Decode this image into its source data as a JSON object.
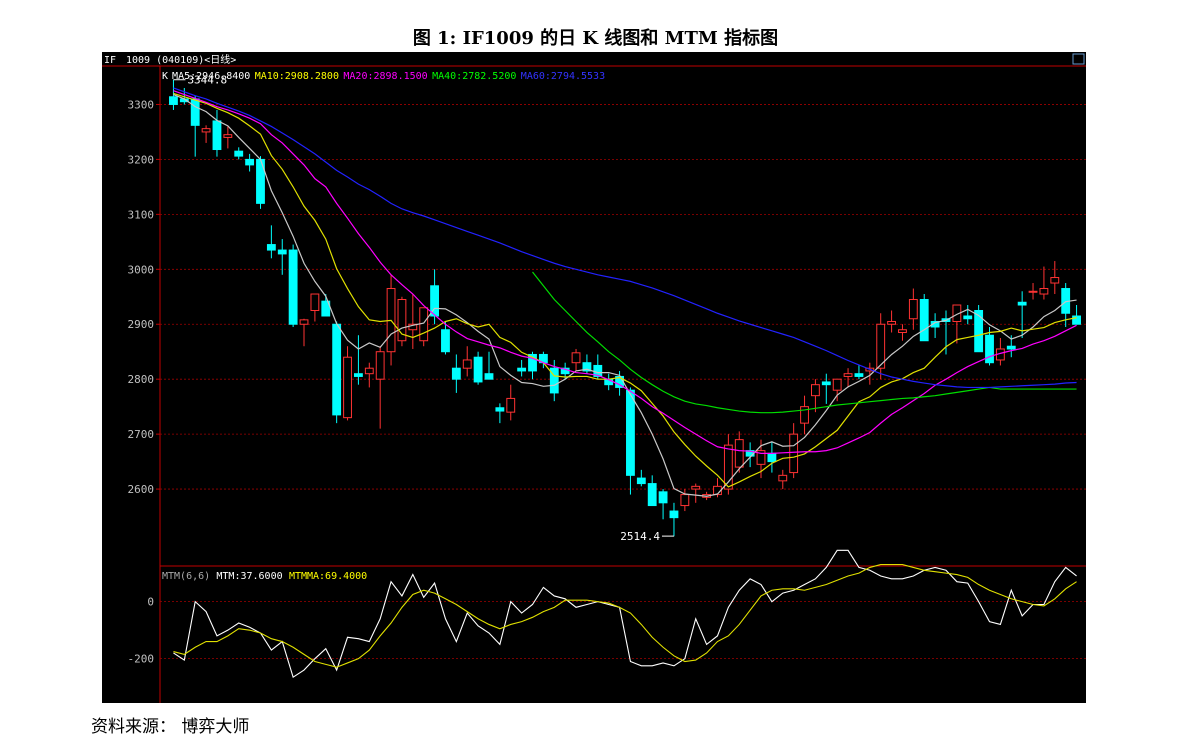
{
  "figure_title": "图 1:  IF1009 的日 K 线图和 MTM 指标图",
  "source_label": "资料来源：  博弈大师",
  "header": {
    "symbol": "IF",
    "contract": "1009",
    "code": "(040109)",
    "period": "<日线>"
  },
  "main_legend": [
    {
      "label": "K",
      "color": "#ffffff"
    },
    {
      "label": "MA5:2946.8400",
      "color": "#ffffff"
    },
    {
      "label": "MA10:2908.2800",
      "color": "#ffff00"
    },
    {
      "label": "MA20:2898.1500",
      "color": "#ff00ff"
    },
    {
      "label": "MA40:2782.5200",
      "color": "#00ff00"
    },
    {
      "label": "MA60:2794.5533",
      "color": "#3333ff"
    }
  ],
  "sub_legend": [
    {
      "label": "MTM(6,6)",
      "color": "#aaaaaa"
    },
    {
      "label": "MTM:37.6000",
      "color": "#ffffff"
    },
    {
      "label": "MTMMA:69.4000",
      "color": "#ffff00"
    }
  ],
  "annotations": {
    "high": "3344.8",
    "low": "2514.4"
  },
  "colors": {
    "up": "#ff3333",
    "down": "#00ffff",
    "grid": "#a00000",
    "axis": "#c00000",
    "panel_bg": "#000000"
  },
  "chart_data": [
    {
      "type": "candlestick",
      "title": "IF1009 日K线",
      "y_ticks": [
        2600,
        2700,
        2800,
        2900,
        3000,
        3100,
        3200,
        3300
      ],
      "ylim": [
        2460,
        3370
      ],
      "candles": [
        [
          3314,
          3345,
          3290,
          3300
        ],
        [
          3310,
          3330,
          3300,
          3305
        ],
        [
          3310,
          3316,
          3205,
          3262
        ],
        [
          3250,
          3262,
          3230,
          3256
        ],
        [
          3270,
          3290,
          3205,
          3218
        ],
        [
          3240,
          3260,
          3220,
          3245
        ],
        [
          3215,
          3222,
          3200,
          3206
        ],
        [
          3200,
          3210,
          3178,
          3190
        ],
        [
          3200,
          3206,
          3110,
          3120
        ],
        [
          3045,
          3080,
          3020,
          3035
        ],
        [
          3035,
          3055,
          2990,
          3028
        ],
        [
          3035,
          3045,
          2895,
          2900
        ],
        [
          2900,
          2910,
          2860,
          2908
        ],
        [
          2925,
          2950,
          2905,
          2955
        ],
        [
          2942,
          2955,
          2915,
          2915
        ],
        [
          2900,
          2905,
          2720,
          2735
        ],
        [
          2730,
          2860,
          2725,
          2840
        ],
        [
          2810,
          2880,
          2790,
          2805
        ],
        [
          2810,
          2830,
          2785,
          2820
        ],
        [
          2800,
          2860,
          2710,
          2850
        ],
        [
          2850,
          2990,
          2825,
          2965
        ],
        [
          2870,
          2950,
          2860,
          2945
        ],
        [
          2890,
          2955,
          2855,
          2900
        ],
        [
          2870,
          2920,
          2860,
          2930
        ],
        [
          2970,
          3000,
          2900,
          2915
        ],
        [
          2890,
          2905,
          2845,
          2850
        ],
        [
          2820,
          2845,
          2775,
          2800
        ],
        [
          2820,
          2860,
          2805,
          2835
        ],
        [
          2840,
          2850,
          2790,
          2795
        ],
        [
          2810,
          2850,
          2800,
          2800
        ],
        [
          2748,
          2756,
          2720,
          2742
        ],
        [
          2740,
          2790,
          2725,
          2765
        ],
        [
          2820,
          2835,
          2805,
          2815
        ],
        [
          2845,
          2850,
          2800,
          2815
        ],
        [
          2845,
          2850,
          2820,
          2830
        ],
        [
          2820,
          2835,
          2760,
          2775
        ],
        [
          2820,
          2830,
          2800,
          2810
        ],
        [
          2830,
          2855,
          2815,
          2848
        ],
        [
          2830,
          2845,
          2810,
          2815
        ],
        [
          2825,
          2845,
          2800,
          2805
        ],
        [
          2800,
          2810,
          2780,
          2790
        ],
        [
          2805,
          2815,
          2770,
          2785
        ],
        [
          2780,
          2785,
          2590,
          2625
        ],
        [
          2620,
          2635,
          2605,
          2610
        ],
        [
          2610,
          2625,
          2570,
          2570
        ],
        [
          2595,
          2600,
          2545,
          2575
        ],
        [
          2560,
          2575,
          2514,
          2548
        ],
        [
          2570,
          2600,
          2560,
          2590
        ],
        [
          2600,
          2610,
          2575,
          2605
        ],
        [
          2585,
          2595,
          2580,
          2590
        ],
        [
          2590,
          2620,
          2585,
          2605
        ],
        [
          2600,
          2700,
          2590,
          2680
        ],
        [
          2640,
          2705,
          2630,
          2690
        ],
        [
          2670,
          2685,
          2640,
          2660
        ],
        [
          2645,
          2690,
          2620,
          2670
        ],
        [
          2665,
          2685,
          2630,
          2650
        ],
        [
          2615,
          2635,
          2600,
          2625
        ],
        [
          2630,
          2720,
          2620,
          2700
        ],
        [
          2720,
          2770,
          2700,
          2750
        ],
        [
          2770,
          2800,
          2740,
          2790
        ],
        [
          2795,
          2810,
          2755,
          2790
        ],
        [
          2780,
          2800,
          2760,
          2800
        ],
        [
          2805,
          2820,
          2785,
          2810
        ],
        [
          2810,
          2825,
          2800,
          2805
        ],
        [
          2815,
          2830,
          2790,
          2820
        ],
        [
          2820,
          2920,
          2800,
          2900
        ],
        [
          2900,
          2925,
          2885,
          2905
        ],
        [
          2885,
          2900,
          2870,
          2890
        ],
        [
          2910,
          2965,
          2890,
          2945
        ],
        [
          2945,
          2955,
          2870,
          2870
        ],
        [
          2905,
          2920,
          2875,
          2895
        ],
        [
          2910,
          2925,
          2845,
          2905
        ],
        [
          2905,
          2935,
          2865,
          2935
        ],
        [
          2915,
          2935,
          2900,
          2910
        ],
        [
          2925,
          2935,
          2850,
          2850
        ],
        [
          2880,
          2895,
          2825,
          2830
        ],
        [
          2835,
          2875,
          2825,
          2855
        ],
        [
          2860,
          2880,
          2840,
          2855
        ],
        [
          2940,
          2960,
          2875,
          2935
        ],
        [
          2960,
          2975,
          2945,
          2960
        ],
        [
          2955,
          3005,
          2945,
          2965
        ],
        [
          2975,
          3015,
          2955,
          2985
        ],
        [
          2965,
          2975,
          2895,
          2920
        ],
        [
          2915,
          2935,
          2905,
          2900
        ]
      ],
      "series": [
        {
          "name": "MA5",
          "values": [
            3318,
            3310,
            3296,
            3287,
            3271,
            3261,
            3240,
            3220,
            3200,
            3143,
            3103,
            3060,
            3011,
            2978,
            2951,
            2901,
            2871,
            2855,
            2866,
            2858,
            2882,
            2893,
            2898,
            2902,
            2929,
            2928,
            2917,
            2903,
            2887,
            2873,
            2823,
            2807,
            2794,
            2792,
            2787,
            2789,
            2800,
            2815,
            2818,
            2812,
            2812,
            2807,
            2772,
            2739,
            2700,
            2655,
            2601,
            2591,
            2589,
            2587,
            2591,
            2613,
            2637,
            2658,
            2679,
            2686,
            2678,
            2679,
            2694,
            2717,
            2743,
            2771,
            2786,
            2796,
            2807,
            2826,
            2845,
            2860,
            2878,
            2890,
            2903,
            2907,
            2918,
            2927,
            2916,
            2899,
            2888,
            2873,
            2880,
            2895,
            2914,
            2925,
            2941,
            2944
          ]
        },
        {
          "name": "MA10",
          "values": [
            3320,
            3314,
            3308,
            3302,
            3293,
            3285,
            3275,
            3261,
            3246,
            3207,
            3182,
            3150,
            3115,
            3089,
            3055,
            3001,
            2965,
            2932,
            2908,
            2905,
            2907,
            2882,
            2876,
            2884,
            2893,
            2905,
            2910,
            2901,
            2895,
            2900,
            2876,
            2867,
            2849,
            2840,
            2830,
            2806,
            2804,
            2805,
            2805,
            2800,
            2800,
            2803,
            2793,
            2779,
            2756,
            2733,
            2704,
            2681,
            2660,
            2642,
            2625,
            2604,
            2613,
            2623,
            2632,
            2647,
            2656,
            2658,
            2664,
            2677,
            2692,
            2707,
            2733,
            2759,
            2768,
            2785,
            2795,
            2801,
            2812,
            2820,
            2840,
            2859,
            2872,
            2876,
            2880,
            2885,
            2887,
            2893,
            2888,
            2891,
            2894,
            2903,
            2908,
            2912
          ]
        },
        {
          "name": "MA20",
          "values": [
            3325,
            3318,
            3311,
            3304,
            3296,
            3290,
            3283,
            3275,
            3265,
            3245,
            3230,
            3210,
            3190,
            3165,
            3150,
            3120,
            3093,
            3065,
            3040,
            3013,
            2990,
            2972,
            2955,
            2934,
            2917,
            2900,
            2886,
            2874,
            2868,
            2862,
            2857,
            2849,
            2842,
            2838,
            2830,
            2823,
            2818,
            2812,
            2810,
            2807,
            2799,
            2790,
            2778,
            2765,
            2750,
            2738,
            2725,
            2712,
            2700,
            2688,
            2677,
            2673,
            2670,
            2669,
            2665,
            2665,
            2666,
            2667,
            2668,
            2668,
            2670,
            2675,
            2684,
            2693,
            2703,
            2720,
            2736,
            2748,
            2761,
            2774,
            2789,
            2800,
            2812,
            2823,
            2832,
            2841,
            2847,
            2852,
            2856,
            2864,
            2870,
            2878,
            2888,
            2898
          ]
        },
        {
          "name": "MA40",
          "values": [
            null,
            null,
            null,
            null,
            null,
            null,
            null,
            null,
            null,
            null,
            null,
            null,
            null,
            null,
            null,
            null,
            null,
            null,
            null,
            null,
            null,
            null,
            null,
            null,
            null,
            null,
            null,
            null,
            null,
            null,
            null,
            null,
            null,
            null,
            null,
            null,
            null,
            null,
            null,
            null,
            null,
            null,
            null,
            null,
            null,
            null,
            null,
            null,
            null,
            null,
            null,
            null,
            null,
            null,
            null,
            null,
            null,
            null,
            null,
            null,
            null,
            null,
            null,
            null,
            null,
            null,
            null,
            null,
            null,
            null,
            null,
            null,
            null,
            null,
            null,
            null,
            null,
            null,
            null,
            null,
            null,
            null,
            null,
            null
          ]
        },
        {
          "name": "MA60",
          "values": [
            3330,
            3323,
            3316,
            3310,
            3302,
            3295,
            3288,
            3280,
            3270,
            3260,
            3248,
            3236,
            3223,
            3210,
            3195,
            3180,
            3168,
            3155,
            3145,
            3133,
            3120,
            3110,
            3103,
            3097,
            3090,
            3083,
            3076,
            3069,
            3062,
            3055,
            3048,
            3040,
            3032,
            3025,
            3018,
            3011,
            3005,
            3000,
            2995,
            2990,
            2986,
            2982,
            2978,
            2972,
            2966,
            2959,
            2952,
            2944,
            2936,
            2928,
            2920,
            2913,
            2906,
            2900,
            2894,
            2888,
            2882,
            2876,
            2868,
            2860,
            2852,
            2843,
            2834,
            2826,
            2818,
            2810,
            2804,
            2800,
            2796,
            2793,
            2790,
            2788,
            2786,
            2785,
            2785,
            2785,
            2786,
            2787,
            2788,
            2789,
            2790,
            2791,
            2793,
            2794
          ]
        }
      ]
    },
    {
      "type": "line",
      "title": "MTM(6,6)",
      "y_ticks": [
        -200,
        0
      ],
      "ylim": [
        -345,
        125
      ],
      "series": [
        {
          "name": "MTM",
          "values": [
            -180,
            -205,
            0,
            -35,
            -120,
            -100,
            -75,
            -90,
            -110,
            -170,
            -140,
            -265,
            -240,
            -200,
            -165,
            -240,
            -125,
            -130,
            -140,
            -60,
            70,
            20,
            95,
            15,
            65,
            -60,
            -140,
            -40,
            -85,
            -110,
            -150,
            0,
            -40,
            -10,
            50,
            20,
            10,
            -20,
            -10,
            0,
            -10,
            -20,
            -210,
            -225,
            -225,
            -215,
            -225,
            -200,
            -60,
            -150,
            -120,
            -20,
            40,
            80,
            60,
            0,
            30,
            40,
            60,
            80,
            120,
            180,
            180,
            120,
            110,
            90,
            80,
            80,
            90,
            110,
            120,
            110,
            70,
            65,
            0,
            -70,
            -80,
            40,
            -50,
            -10,
            -10,
            70,
            120,
            90
          ]
        },
        {
          "name": "MTMMA",
          "values": [
            -175,
            -185,
            -160,
            -140,
            -140,
            -120,
            -95,
            -100,
            -110,
            -130,
            -140,
            -160,
            -185,
            -210,
            -220,
            -230,
            -215,
            -200,
            -170,
            -120,
            -75,
            -20,
            25,
            40,
            30,
            10,
            -10,
            -35,
            -60,
            -80,
            -95,
            -80,
            -70,
            -55,
            -35,
            -20,
            5,
            5,
            5,
            0,
            -5,
            -20,
            -40,
            -80,
            -125,
            -160,
            -190,
            -210,
            -205,
            -180,
            -140,
            -120,
            -80,
            -30,
            20,
            40,
            45,
            45,
            40,
            50,
            60,
            75,
            90,
            100,
            120,
            130,
            130,
            130,
            120,
            110,
            105,
            100,
            95,
            85,
            60,
            40,
            25,
            10,
            0,
            -10,
            -15,
            10,
            45,
            70
          ]
        }
      ]
    }
  ]
}
